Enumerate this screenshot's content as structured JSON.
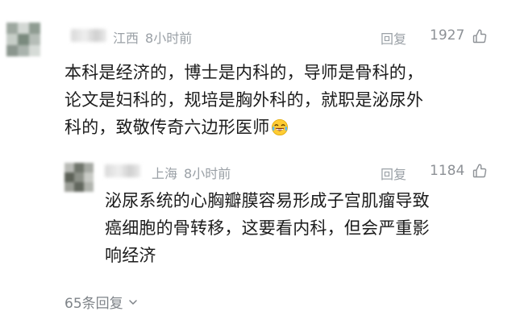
{
  "main_comment": {
    "location": "江西",
    "time": "8小时前",
    "reply_label": "回复",
    "likes": "1927",
    "text_lines": [
      "本科是经济的，博士是内科的，导师是骨科的，",
      "论文是妇科的，规培是胸外科的，就职是泌尿外",
      "科的，致敬传奇六边形医师"
    ],
    "emoji": "laughing-crying-emoji"
  },
  "reply_comment": {
    "location": "上海",
    "time": "8小时前",
    "reply_label": "回复",
    "likes": "1184",
    "text_lines": [
      "泌尿系统的心胸瓣膜容易形成子宫肌瘤导致",
      "癌细胞的骨转移，这要看内科，但会严重影",
      "响经济"
    ]
  },
  "more_replies": {
    "label": "65条回复"
  },
  "colors": {
    "meta_gray": "#9aa0a6",
    "text": "#1c1c1c",
    "background": "#ffffff"
  }
}
